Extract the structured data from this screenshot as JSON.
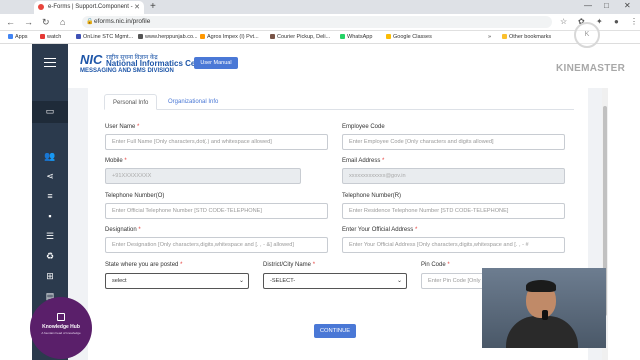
{
  "browser": {
    "tab_title": "e-Forms | Support.Component -",
    "url": "eforms.nic.in/profile",
    "bookmarks": [
      {
        "label": "Apps",
        "color": "#4285f4"
      },
      {
        "label": "watch",
        "color": "#e53935"
      },
      {
        "label": "OnLine STC Mgmt...",
        "color": "#3f51b5"
      },
      {
        "label": "www.herppunjab.co...",
        "color": "#555555"
      },
      {
        "label": "Agros Impex (I) Pvt...",
        "color": "#ff9800"
      },
      {
        "label": "Courier Pickup, Deli...",
        "color": "#795548"
      },
      {
        "label": "WhatsApp",
        "color": "#25d366"
      },
      {
        "label": "Google Classes",
        "color": "#fbbc05"
      }
    ],
    "other_bookmarks": "Other bookmarks"
  },
  "header": {
    "logo_abbr": "NIC",
    "logo_hindi": "राष्ट्रीय सूचना विज्ञान केंद्र",
    "logo_name": "National Informatics Centre",
    "logo_division": "MESSAGING AND SMS DIVISION",
    "user_manual": "User Manual"
  },
  "form": {
    "tabs": [
      "Personal Info",
      "Organizational Info"
    ],
    "fields": {
      "user_name": {
        "label": "User Name",
        "placeholder": "Enter Full Name [Only characters,dot(.) and whitespace allowed]"
      },
      "employee_code": {
        "label": "Employee Code",
        "placeholder": "Enter Employee Code [Only characters and digits allowed]"
      },
      "mobile": {
        "label": "Mobile",
        "value": "+91XXXXXXXX"
      },
      "email": {
        "label": "Email Address",
        "value": "xxxxxxxxxxxxx@gov.in"
      },
      "telephone_o": {
        "label": "Telephone Number(O)",
        "placeholder": "Enter Official Telephone Number [STD CODE-TELEPHONE]"
      },
      "telephone_r": {
        "label": "Telephone Number(R)",
        "placeholder": "Enter Residence Telephone Number [STD CODE-TELEPHONE]"
      },
      "designation": {
        "label": "Designation",
        "placeholder": "Enter Designation [Only characters,digits,whitespace and [. , - &] allowed]"
      },
      "official_address": {
        "label": "Enter Your Official Address",
        "placeholder": "Enter Your Official Address [Only characters,digits,whitespace and [. , - #"
      },
      "state": {
        "label": "State where you are posted",
        "selected": "select"
      },
      "district": {
        "label": "District/City Name",
        "selected": "-SELECT-"
      },
      "pin": {
        "label": "Pin Code",
        "placeholder": "Enter Pin Code [Only"
      }
    },
    "continue_label": "CONTINUE"
  },
  "overlays": {
    "badge_title": "Knowledge Hub",
    "badge_sub": "A fountain head of knowledge",
    "watermark": "KINEMASTER"
  }
}
